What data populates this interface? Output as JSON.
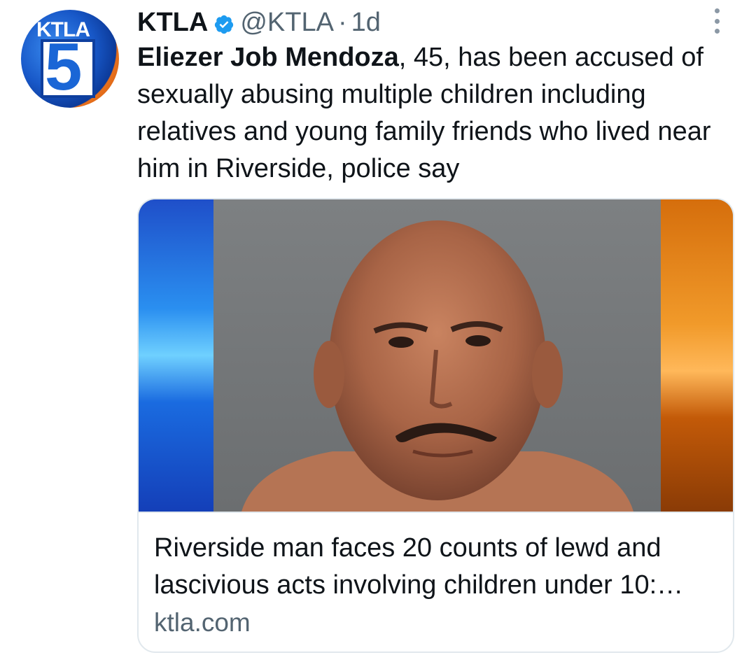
{
  "tweet": {
    "author_name": "KTLA",
    "handle": "@KTLA",
    "separator": "·",
    "time": "1d",
    "text_bold": "Eliezer Job Mendoza",
    "text_rest": ", 45, has been accused of sexually abusing multiple children including relatives and young family friends who lived near him in Riverside, police say",
    "avatar_logo_text": "KTLA",
    "avatar_logo_number": "5"
  },
  "card": {
    "image_description_icon": "mugshot-photo",
    "title": "Riverside man faces 20 counts of lewd and lascivious acts involving children under 10:…",
    "domain": "ktla.com"
  },
  "colors": {
    "text_primary": "#0f1419",
    "text_secondary": "#536471",
    "verified_blue": "#1d9bf0",
    "card_border": "#e1e8ed"
  },
  "icons": {
    "verified": "verified-badge-icon",
    "more": "more-options-icon"
  }
}
